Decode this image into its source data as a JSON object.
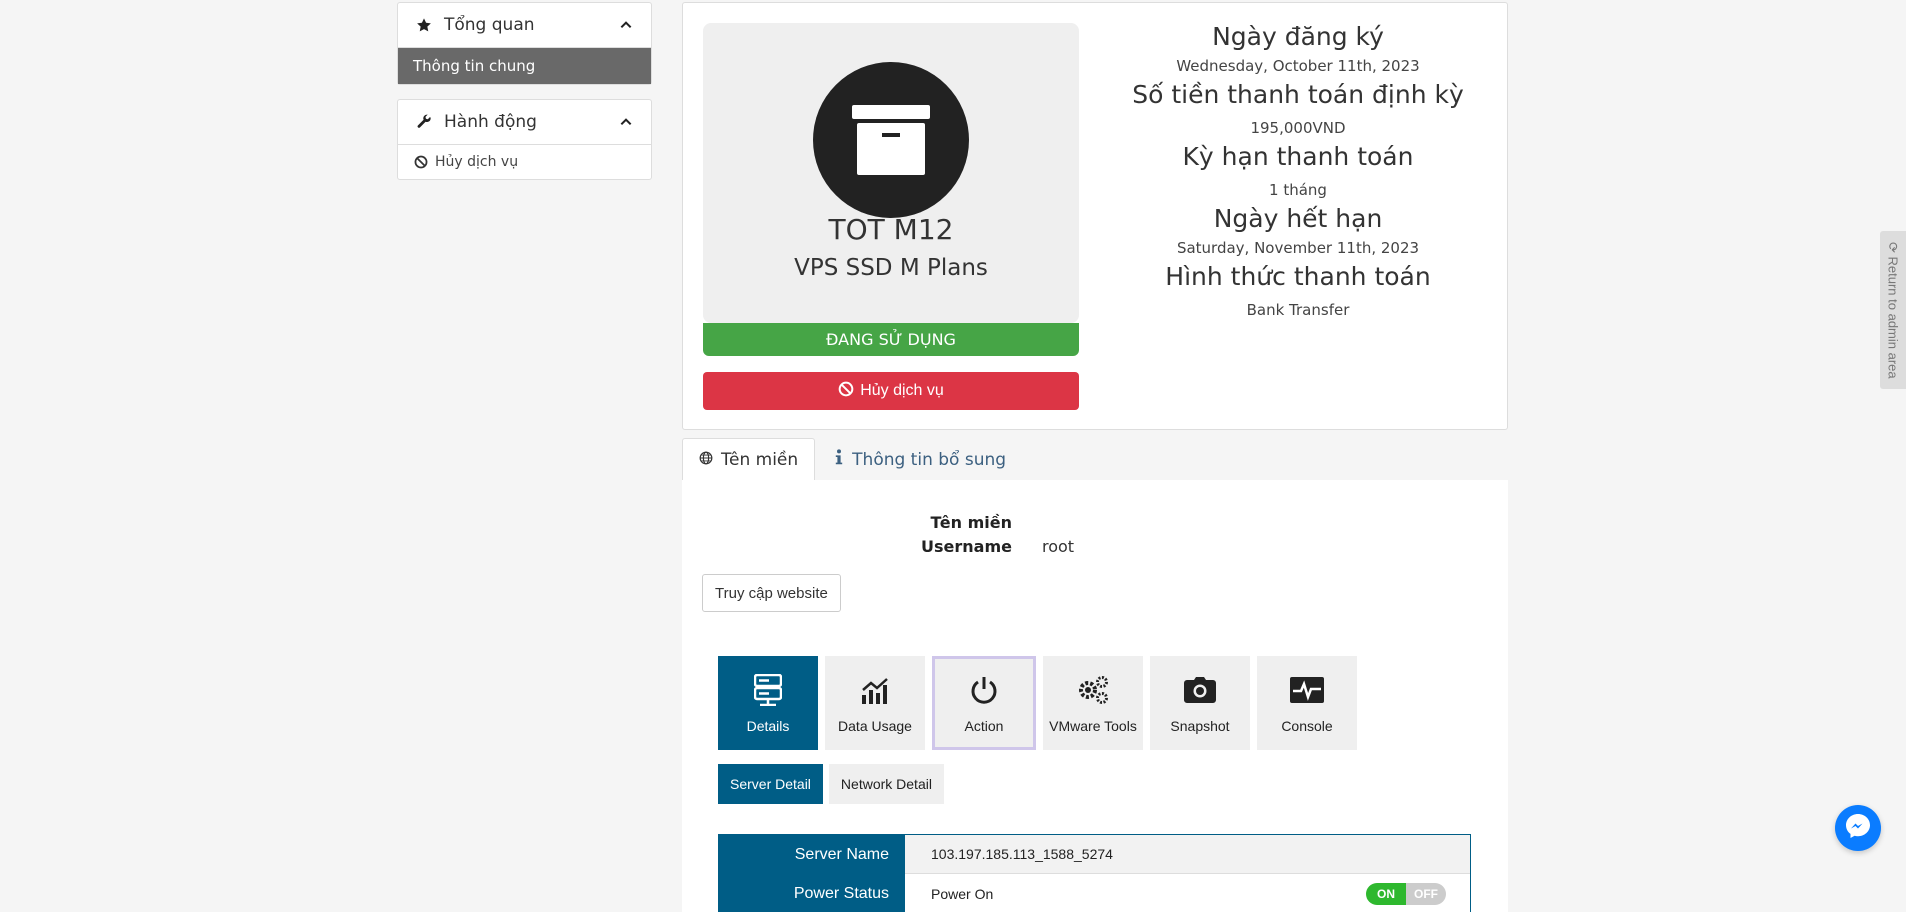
{
  "sidebar": {
    "overview": {
      "title": "Tổng quan",
      "items": [
        {
          "label": "Thông tin chung",
          "active": true
        }
      ]
    },
    "actions": {
      "title": "Hành động",
      "items": [
        {
          "label": "Hủy dịch vụ"
        }
      ]
    }
  },
  "product": {
    "name": "TOT M12",
    "plan": "VPS SSD M Plans",
    "status": "ĐANG SỬ DỤNG",
    "cancel_label": "Hủy dịch vụ"
  },
  "info": {
    "reg_date_label": "Ngày đăng ký",
    "reg_date": "Wednesday, October 11th, 2023",
    "recurring_label": "Số tiền thanh toán định kỳ",
    "recurring": "195,000VND",
    "cycle_label": "Kỳ hạn thanh toán",
    "cycle": "1 tháng",
    "due_label": "Ngày hết hạn",
    "due": "Saturday, November 11th, 2023",
    "payment_label": "Hình thức thanh toán",
    "payment": "Bank Transfer"
  },
  "tabs": [
    {
      "label": "Tên miền",
      "icon": "globe-icon",
      "active": true
    },
    {
      "label": "Thông tin bổ sung",
      "icon": "info-icon",
      "active": false
    }
  ],
  "domain": {
    "domain_label": "Tên miền",
    "domain_value": "",
    "username_label": "Username",
    "username_value": "root",
    "visit_label": "Truy cập website"
  },
  "tools": [
    {
      "label": "Details",
      "icon": "server-icon",
      "active": true
    },
    {
      "label": "Data Usage",
      "icon": "chart-icon",
      "active": false
    },
    {
      "label": "Action",
      "icon": "power-icon",
      "active": false
    },
    {
      "label": "VMware Tools",
      "icon": "gears-icon",
      "active": false
    },
    {
      "label": "Snapshot",
      "icon": "camera-icon",
      "active": false
    },
    {
      "label": "Console",
      "icon": "heartbeat-icon",
      "active": false
    }
  ],
  "subtabs": [
    {
      "label": "Server Detail",
      "active": true
    },
    {
      "label": "Network Detail",
      "active": false
    }
  ],
  "details": [
    {
      "label": "Server Name",
      "value": "103.197.185.113_1588_5274"
    },
    {
      "label": "Power Status",
      "value": "Power On",
      "toggle_on": "ON",
      "toggle_off": "OFF"
    }
  ],
  "admin_tab": "Return to admin area",
  "colors": {
    "primary": "#005d86",
    "success": "#46a546",
    "danger": "#dc3545",
    "toggle_on": "#2eb82e"
  }
}
